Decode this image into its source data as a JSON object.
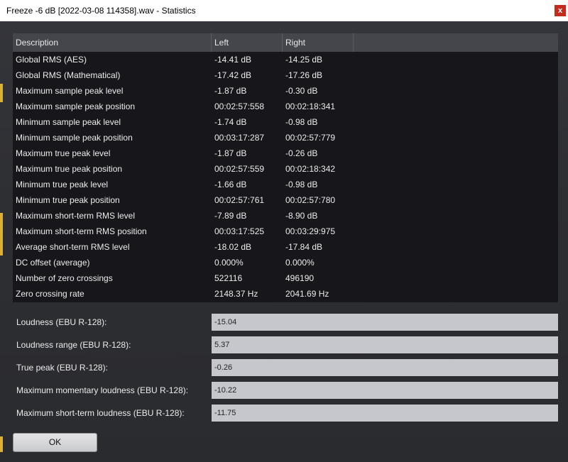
{
  "window": {
    "title": "Freeze -6 dB [2022-03-08 114358].wav - Statistics",
    "close_label": "x"
  },
  "table": {
    "headers": [
      "Description",
      "Left",
      "Right"
    ],
    "rows": [
      [
        "Global RMS (AES)",
        "-14.41 dB",
        "-14.25 dB"
      ],
      [
        "Global RMS (Mathematical)",
        "-17.42 dB",
        "-17.26 dB"
      ],
      [
        "Maximum sample peak level",
        "-1.87 dB",
        "-0.30 dB"
      ],
      [
        "Maximum sample peak position",
        "00:02:57:558",
        "00:02:18:341"
      ],
      [
        "Minimum sample peak level",
        "-1.74 dB",
        "-0.98 dB"
      ],
      [
        "Minimum sample peak position",
        "00:03:17:287",
        "00:02:57:779"
      ],
      [
        "Maximum true peak level",
        "-1.87 dB",
        "-0.26 dB"
      ],
      [
        "Maximum true peak position",
        "00:02:57:559",
        "00:02:18:342"
      ],
      [
        "Minimum true peak level",
        "-1.66 dB",
        "-0.98 dB"
      ],
      [
        "Minimum true peak position",
        "00:02:57:761",
        "00:02:57:780"
      ],
      [
        "Maximum short-term RMS level",
        "-7.89 dB",
        "-8.90 dB"
      ],
      [
        "Maximum short-term RMS position",
        "00:03:17:525",
        "00:03:29:975"
      ],
      [
        "Average short-term RMS level",
        "-18.02 dB",
        "-17.84 dB"
      ],
      [
        "DC offset (average)",
        "0.000%",
        "0.000%"
      ],
      [
        "Number of zero crossings",
        "522116",
        "496190"
      ],
      [
        "Zero crossing rate",
        "2148.37 Hz",
        "2041.69 Hz"
      ]
    ]
  },
  "loudness": [
    {
      "label": "Loudness (EBU R-128):",
      "value": "-15.04"
    },
    {
      "label": "Loudness range (EBU R-128):",
      "value": "5.37"
    },
    {
      "label": "True peak (EBU R-128):",
      "value": "-0.26"
    },
    {
      "label": "Maximum momentary loudness (EBU R-128):",
      "value": "-10.22"
    },
    {
      "label": "Maximum short-term loudness (EBU R-128):",
      "value": "-11.75"
    }
  ],
  "ok_label": "OK",
  "colors": {
    "accent_edge": "#d9b13a",
    "close_red": "#c42b1c"
  }
}
